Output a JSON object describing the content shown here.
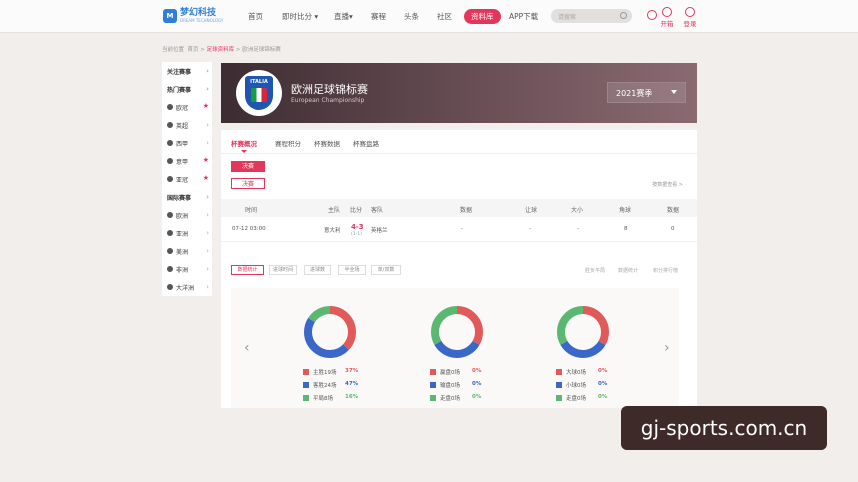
{
  "nav": {
    "logo_name": "梦幻科技",
    "logo_sub": "DREAM TECHNOLOGY",
    "items": [
      "首页",
      "即时比分 ▾",
      "直播▾",
      "赛程",
      "头条",
      "社区",
      "资料库",
      "APP下载"
    ],
    "search_placeholder": "请搜索",
    "open_label": "开箱",
    "login_label": "登录"
  },
  "breadcrumb": {
    "prefix": "当前位置",
    "home": "首页",
    "sep1": ">",
    "section": "足球资料库",
    "sep2": ">",
    "current": "欧洲足球锦标赛"
  },
  "sidebar": [
    {
      "label": "关注赛事",
      "type": "head"
    },
    {
      "label": "热门赛事",
      "type": "head"
    },
    {
      "label": "欧冠",
      "type": "star"
    },
    {
      "label": "英超",
      "type": "item"
    },
    {
      "label": "西甲",
      "type": "item"
    },
    {
      "label": "意甲",
      "type": "star"
    },
    {
      "label": "亚冠",
      "type": "star"
    },
    {
      "label": "国际赛事",
      "type": "head"
    },
    {
      "label": "欧洲",
      "type": "item"
    },
    {
      "label": "亚洲",
      "type": "item"
    },
    {
      "label": "美洲",
      "type": "item"
    },
    {
      "label": "非洲",
      "type": "item"
    },
    {
      "label": "大洋洲",
      "type": "item"
    }
  ],
  "banner": {
    "crest_text": "ITALIA",
    "title": "欧洲足球锦标赛",
    "subtitle": "European Championship",
    "season": "2021赛季"
  },
  "tabs": [
    "杯赛概况",
    "赛程积分",
    "杯赛数据",
    "杯赛盘路"
  ],
  "stage_pills": [
    "决赛",
    "决赛"
  ],
  "note": "按数据查看 >",
  "table": {
    "headers": [
      "时间",
      "主队",
      "比分",
      "客队",
      "数据",
      "让球",
      "大小",
      "角球",
      "数据"
    ],
    "row": {
      "time": "07-12 03:00",
      "home": "意大利",
      "score": "4-3",
      "sub": "(1-1)",
      "away": "英格兰",
      "data": "-",
      "handicap": "-",
      "ou": "-",
      "corner": "8",
      "extra": "0"
    }
  },
  "filter_tabs": [
    "数据统计",
    "进球时间",
    "进球数",
    "半全场",
    "单/双数"
  ],
  "filter_links": [
    "胜负平局",
    "数据统计",
    "积分排行榜"
  ],
  "stats": [
    {
      "items": [
        {
          "label": "主胜19场",
          "pct": "37%",
          "color": "#e05a5a"
        },
        {
          "label": "客胜24场",
          "pct": "47%",
          "color": "#3a67c8"
        },
        {
          "label": "平局8场",
          "pct": "16%",
          "color": "#5bb872"
        }
      ]
    },
    {
      "items": [
        {
          "label": "赢盘0场",
          "pct": "0%",
          "color": "#e05a5a"
        },
        {
          "label": "输盘0场",
          "pct": "0%",
          "color": "#3a67c8"
        },
        {
          "label": "走盘0场",
          "pct": "0%",
          "color": "#5bb872"
        }
      ]
    },
    {
      "items": [
        {
          "label": "大球0场",
          "pct": "0%",
          "color": "#e05a5a"
        },
        {
          "label": "小球0场",
          "pct": "0%",
          "color": "#3a67c8"
        },
        {
          "label": "走盘0场",
          "pct": "0%",
          "color": "#5bb872"
        }
      ]
    }
  ],
  "watermark": "gj-sports.com.cn"
}
